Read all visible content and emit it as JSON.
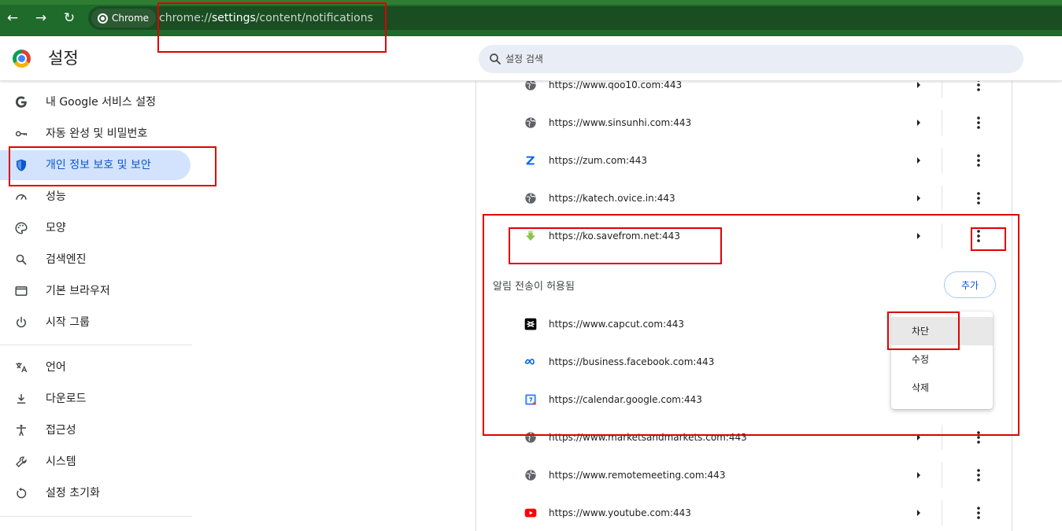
{
  "toolbar": {
    "back_label": "←",
    "forward_label": "→",
    "reload_label": "↻",
    "chip_label": "Chrome",
    "url_prefix": "chrome://",
    "url_host": "settings",
    "url_path": "/content/notifications"
  },
  "header": {
    "title": "설정",
    "search_placeholder": "설정 검색"
  },
  "sidebar": {
    "items": [
      {
        "label": "내 Google 서비스 설정",
        "icon": "google-g-icon"
      },
      {
        "label": "자동 완성 및 비밀번호",
        "icon": "key-icon"
      },
      {
        "label": "개인 정보 보호 및 보안",
        "icon": "shield-icon",
        "active": true
      },
      {
        "label": "성능",
        "icon": "speedometer-icon"
      },
      {
        "label": "모양",
        "icon": "palette-icon"
      },
      {
        "label": "검색엔진",
        "icon": "search-icon"
      },
      {
        "label": "기본 브라우저",
        "icon": "browser-window-icon"
      },
      {
        "label": "시작 그룹",
        "icon": "power-icon"
      },
      {
        "label": "언어",
        "icon": "translate-icon"
      },
      {
        "label": "다운로드",
        "icon": "download-icon"
      },
      {
        "label": "접근성",
        "icon": "accessibility-icon"
      },
      {
        "label": "시스템",
        "icon": "wrench-icon"
      },
      {
        "label": "설정 초기화",
        "icon": "reset-icon"
      }
    ]
  },
  "blocked_sites": [
    {
      "url": "https://www.qoo10.com:443",
      "icon": "globe-icon"
    },
    {
      "url": "https://www.sinsunhi.com:443",
      "icon": "globe-icon"
    },
    {
      "url": "https://zum.com:443",
      "icon": "zum-icon"
    },
    {
      "url": "https://katech.ovice.in:443",
      "icon": "globe-icon"
    },
    {
      "url": "https://ko.savefrom.net:443",
      "icon": "savefrom-icon"
    }
  ],
  "allowed_section": {
    "label": "알림 전송이 허용됨",
    "add_label": "추가"
  },
  "allowed_sites": [
    {
      "url": "https://www.capcut.com:443",
      "icon": "capcut-icon"
    },
    {
      "url": "https://business.facebook.com:443",
      "icon": "meta-icon"
    },
    {
      "url": "https://calendar.google.com:443",
      "icon": "google-calendar-icon"
    },
    {
      "url": "https://www.marketsandmarkets.com:443",
      "icon": "globe-icon"
    },
    {
      "url": "https://www.remotemeeting.com:443",
      "icon": "globe-icon"
    },
    {
      "url": "https://www.youtube.com:443",
      "icon": "youtube-icon"
    }
  ],
  "context_menu": {
    "items": [
      "차단",
      "수정",
      "삭제"
    ]
  },
  "colors": {
    "accent": "#0b57d0",
    "active_bg": "#d3e3fd",
    "toolbar_bg": "#1e6b2c",
    "annotation": "#e00000"
  }
}
